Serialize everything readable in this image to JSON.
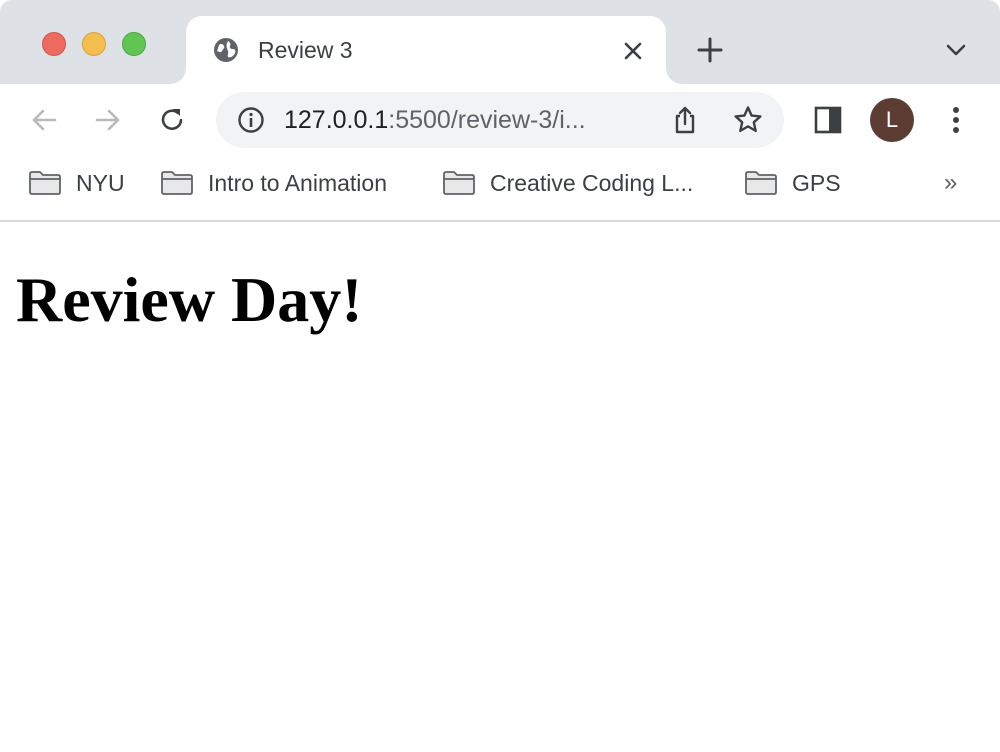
{
  "window": {
    "traffic_lights": {
      "close_color": "#ed6a5e",
      "minimize_color": "#f5bf4f",
      "maximize_color": "#61c554"
    }
  },
  "tab": {
    "title": "Review 3",
    "favicon": "globe-icon",
    "close_icon": "close-icon"
  },
  "tabstrip": {
    "new_tab_icon": "plus-icon",
    "tab_search_icon": "chevron-down-icon"
  },
  "toolbar": {
    "back_icon": "arrow-left-icon",
    "forward_icon": "arrow-right-icon",
    "reload_icon": "reload-icon",
    "side_panel_icon": "side-panel-icon",
    "menu_icon": "kebab-menu-icon",
    "profile_initial": "L",
    "profile_color": "#5d3d33"
  },
  "omnibox": {
    "info_icon": "info-icon",
    "url_host": "127.0.0.1",
    "url_rest": ":5500/review-3/i...",
    "share_icon": "share-icon",
    "bookmark_icon": "star-icon"
  },
  "bookmarks": {
    "items": [
      {
        "label": "NYU",
        "icon": "folder-icon"
      },
      {
        "label": "Intro to Animation",
        "icon": "folder-icon"
      },
      {
        "label": "Creative Coding L...",
        "icon": "folder-icon"
      },
      {
        "label": "GPS",
        "icon": "folder-icon"
      }
    ],
    "overflow_label": "»"
  },
  "page": {
    "heading": "Review Day!"
  }
}
